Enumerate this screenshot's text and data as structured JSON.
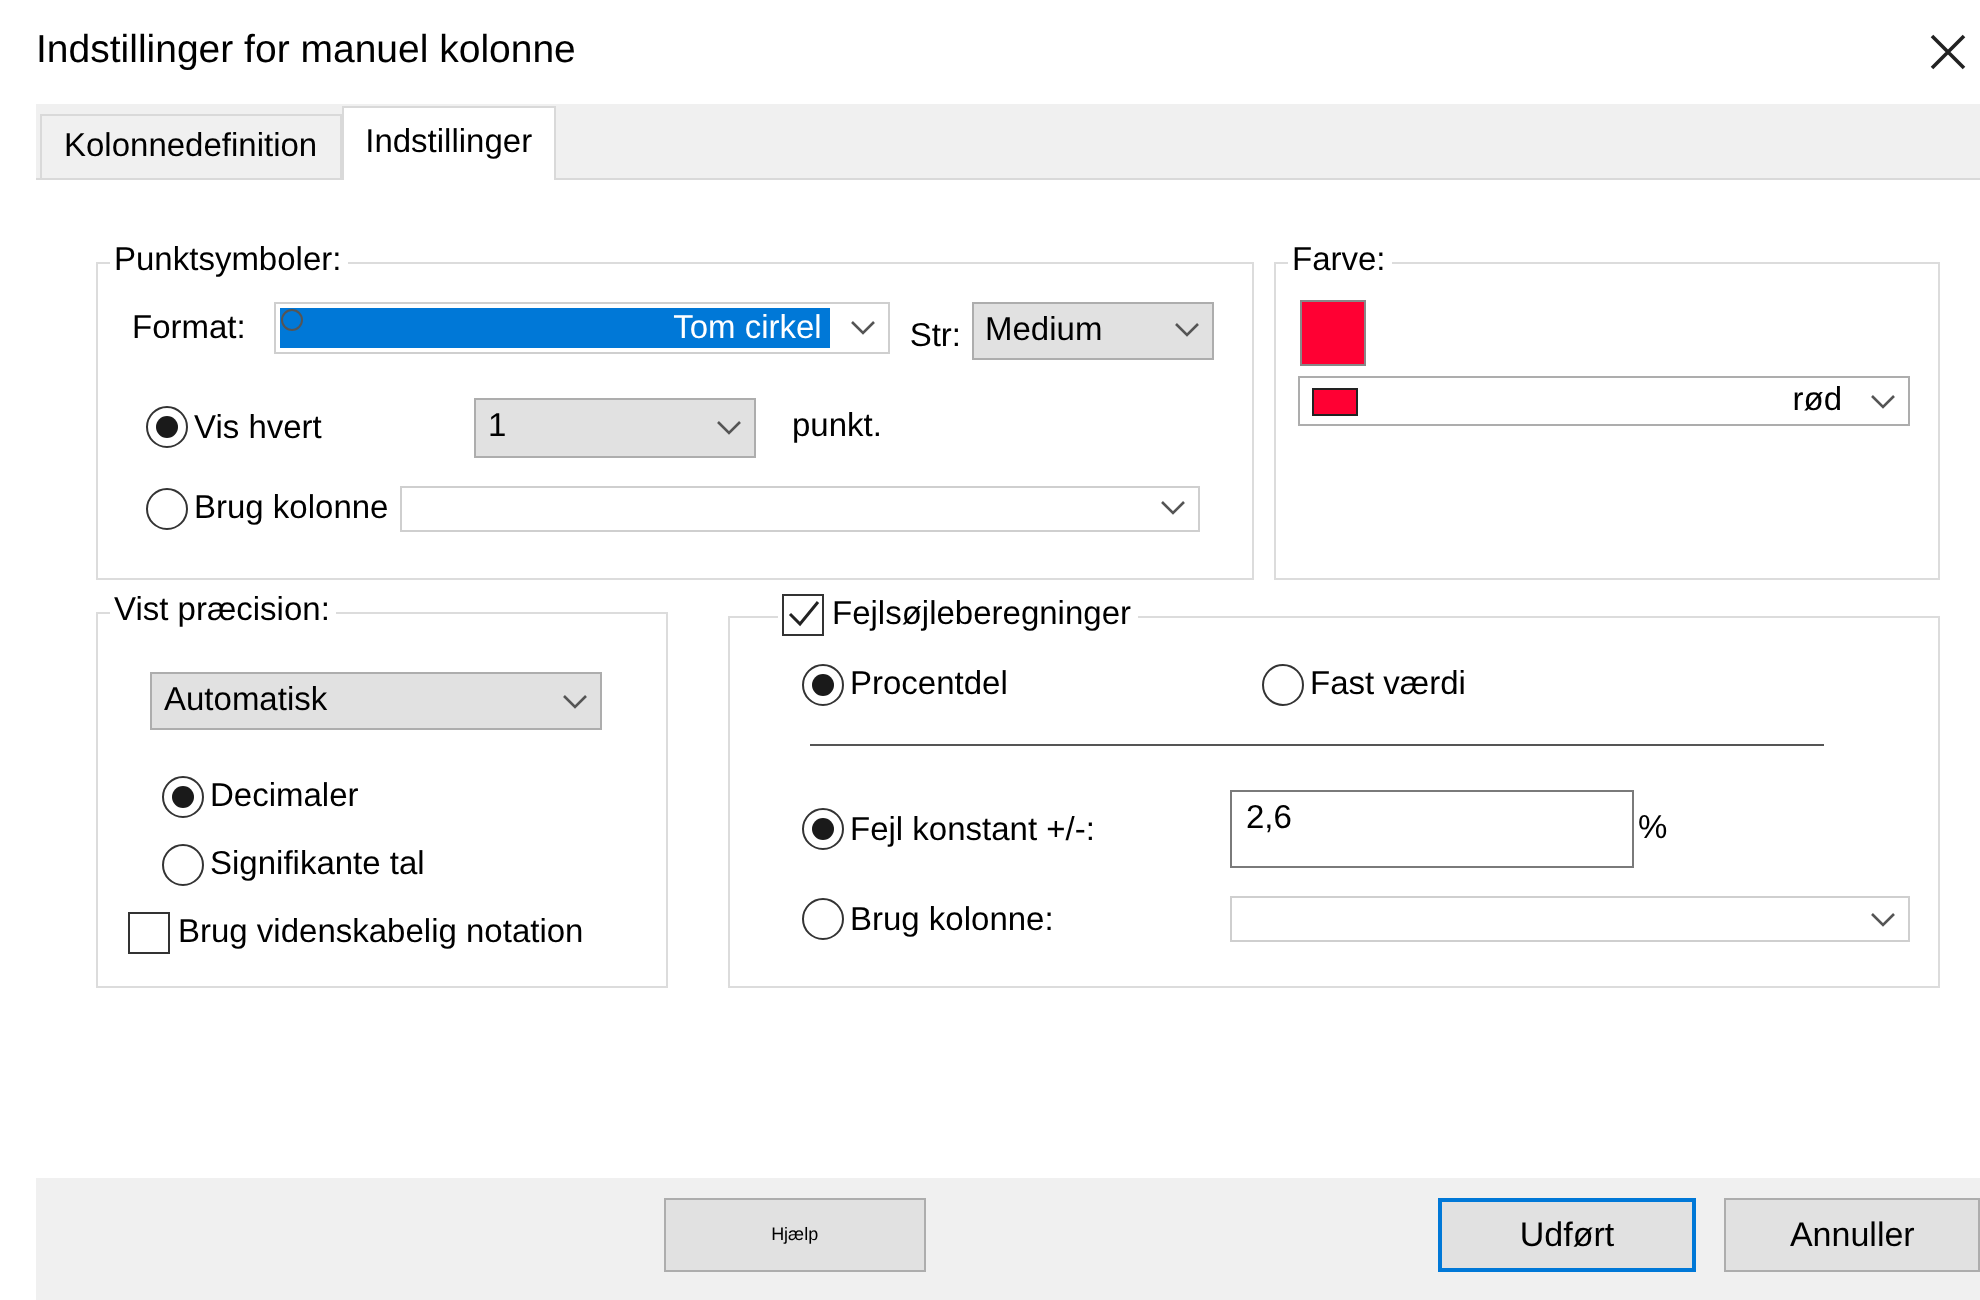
{
  "window": {
    "title": "Indstillinger for manuel kolonne"
  },
  "tabs": [
    {
      "label": "Kolonnedefinition",
      "selected": false
    },
    {
      "label": "Indstillinger",
      "selected": true
    }
  ],
  "point_symbols": {
    "title": "Punktsymboler:",
    "format_label": "Format:",
    "format_value": "Tom cirkel",
    "size_label": "Str:",
    "size_value": "Medium",
    "options": [
      {
        "label": "Vis hvert",
        "selected": true,
        "kind": "every",
        "value": "1",
        "suffix": "punkt."
      },
      {
        "label": "Brug kolonne",
        "selected": false,
        "kind": "column"
      }
    ]
  },
  "color": {
    "title": "Farve:",
    "color": "#ff0033",
    "value": "rød"
  },
  "precision": {
    "title": "Vist præcision:",
    "mode": "Automatisk",
    "options": [
      {
        "label": "Decimaler",
        "selected": true
      },
      {
        "label": "Signifikante tal",
        "selected": false
      }
    ],
    "scientific": {
      "label": "Brug videnskabelig notation",
      "checked": false
    }
  },
  "error_bars": {
    "label": "Fejlsøjleberegninger",
    "checked": true,
    "types": [
      {
        "label": "Procentdel",
        "selected": true
      },
      {
        "label": "Fast værdi",
        "selected": false
      }
    ],
    "sources": [
      {
        "label": "Fejl konstant +/-:",
        "selected": true,
        "kind": "input",
        "value": "2,6",
        "unit": "%"
      },
      {
        "label": "Brug kolonne:",
        "selected": false,
        "kind": "dropdown"
      }
    ]
  },
  "buttons": [
    {
      "label": "Hjælp",
      "kind": "help",
      "default": false
    },
    {
      "label": "Udført",
      "kind": "action",
      "default": true
    },
    {
      "label": "Annuller",
      "kind": "action",
      "default": false
    }
  ]
}
